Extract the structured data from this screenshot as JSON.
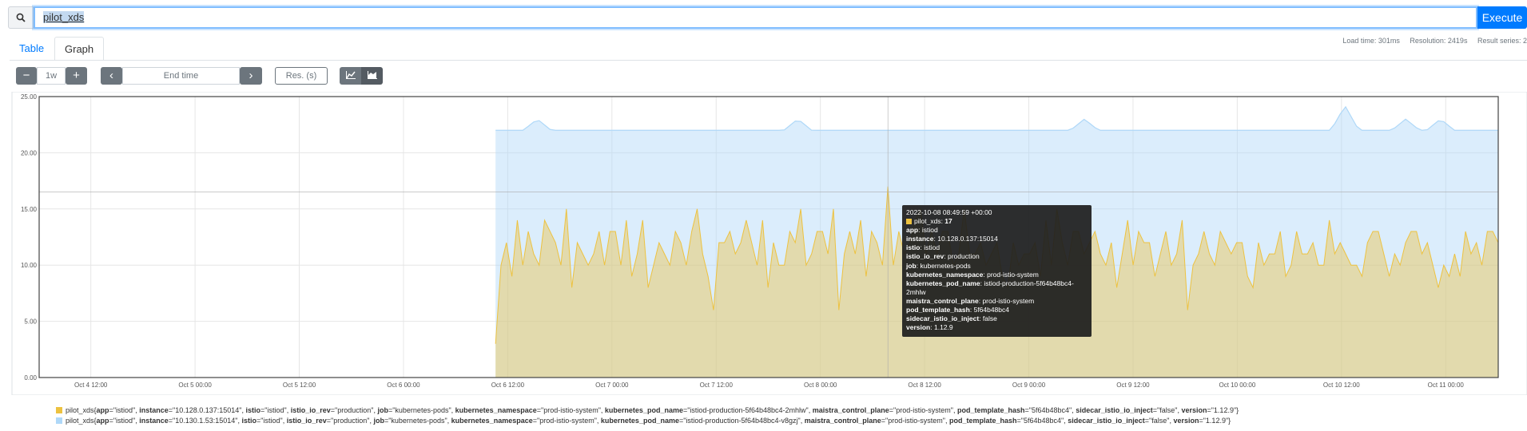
{
  "query": {
    "value": "pilot_xds"
  },
  "execute_label": "Execute",
  "tabs": [
    {
      "label": "Table"
    },
    {
      "label": "Graph"
    }
  ],
  "stats": {
    "load_time": "Load time: 301ms",
    "resolution": "Resolution: 2419s",
    "result_series": "Result series: 2"
  },
  "controls": {
    "minus": "−",
    "range": "1w",
    "plus": "+",
    "prev": "‹",
    "end_time_placeholder": "End time",
    "next": "›",
    "res_placeholder": "Res. (s)"
  },
  "colors": {
    "series1": "#edc240",
    "series2": "#afd8f8",
    "accent": "#007bff"
  },
  "icons": [
    "search-icon",
    "line-chart-icon",
    "stacked-chart-icon"
  ],
  "chart_data": {
    "type": "area",
    "stacked": true,
    "ylim": [
      0,
      25
    ],
    "y_ticks": [
      "0.00",
      "5.00",
      "10.00",
      "15.00",
      "20.00",
      "25.00"
    ],
    "x_ticks": [
      "Oct 4 12:00",
      "Oct 5 00:00",
      "Oct 5 12:00",
      "Oct 6 00:00",
      "Oct 6 12:00",
      "Oct 7 00:00",
      "Oct 7 12:00",
      "Oct 8 00:00",
      "Oct 8 12:00",
      "Oct 9 00:00",
      "Oct 9 12:00",
      "Oct 10 00:00",
      "Oct 10 12:00",
      "Oct 11 00:00"
    ],
    "x_ticks_hours": [
      12,
      24,
      36,
      48,
      60,
      72,
      84,
      96,
      108,
      120,
      132,
      144,
      156,
      168
    ],
    "x_range_hours": [
      6.05,
      174.05
    ],
    "series_start_hours": 58.6,
    "series": [
      {
        "name": "pilot_xds{app=\"istiod\", instance=\"10.128.0.137:15014\", istio=\"istiod\", istio_io_rev=\"production\", job=\"kubernetes-pods\", kubernetes_namespace=\"prod-istio-system\", kubernetes_pod_name=\"istiod-production-5f64b48bc4-2mhlw\", maistra_control_plane=\"prod-istio-system\", pod_template_hash=\"5f64b48bc4\", sidecar_istio_io_inject=\"false\", version=\"1.12.9\"}",
        "values": [
          3,
          10,
          12,
          9,
          14,
          10,
          13,
          11,
          10,
          14,
          13,
          12,
          10,
          15,
          8,
          12,
          11,
          10,
          11,
          13,
          10,
          13,
          13,
          10,
          14,
          9,
          11,
          14,
          8,
          10,
          12,
          11,
          10,
          13,
          12,
          10,
          13,
          15,
          11,
          9,
          6,
          12,
          12,
          13,
          11,
          12,
          14,
          12,
          10,
          14,
          8,
          12,
          10,
          10,
          13,
          12,
          15,
          10,
          11,
          13,
          13,
          11,
          15,
          6,
          11,
          13,
          11,
          14,
          9,
          13,
          12,
          10,
          17,
          10,
          13,
          11,
          12,
          14,
          15,
          11,
          13,
          11,
          13,
          13,
          10,
          11,
          15,
          11,
          11,
          12,
          10,
          11,
          12,
          9,
          8,
          12,
          10,
          11,
          11,
          12,
          9,
          14,
          10,
          15,
          12,
          10,
          13,
          13,
          11,
          12,
          13,
          11,
          10,
          12,
          8,
          11,
          14,
          10,
          13,
          12,
          12,
          9,
          11,
          13,
          10,
          11,
          14,
          6,
          10,
          11,
          13,
          11,
          10,
          13,
          12,
          11,
          12,
          12,
          9,
          8,
          12,
          10,
          11,
          11,
          13,
          9,
          10,
          13,
          11,
          11,
          12,
          10,
          10,
          14,
          11,
          12,
          11,
          10,
          10,
          9,
          12,
          13,
          13,
          11,
          9,
          11,
          10,
          12,
          13,
          13,
          11,
          12,
          10,
          8,
          10,
          9,
          11,
          9,
          13,
          11,
          12,
          10,
          13,
          13,
          12
        ]
      },
      {
        "name": "pilot_xds{app=\"istiod\", instance=\"10.130.1.53:15014\", istio=\"istiod\", istio_io_rev=\"production\", job=\"kubernetes-pods\", kubernetes_namespace=\"prod-istio-system\", kubernetes_pod_name=\"istiod-production-5f64b48bc4-v8gzj\", maistra_control_plane=\"prod-istio-system\", pod_template_hash=\"5f64b48bc4\", sidecar_istio_io_inject=\"false\", version=\"1.12.9\"}",
        "stacked_total": 22,
        "spikes_hours": [
          [
            63.4,
            23
          ],
          [
            64.4,
            21.2
          ],
          [
            93.4,
            23
          ],
          [
            126.4,
            23
          ],
          [
            156.4,
            24.2
          ],
          [
            163.4,
            23
          ],
          [
            167.4,
            23
          ]
        ]
      }
    ]
  },
  "tooltip": {
    "time": "2022-10-08 08:49:59 +00:00",
    "metric": "pilot_xds",
    "value": "17",
    "labels": [
      {
        "k": "app",
        "v": "istiod"
      },
      {
        "k": "instance",
        "v": "10.128.0.137:15014"
      },
      {
        "k": "istio",
        "v": "istiod"
      },
      {
        "k": "istio_io_rev",
        "v": "production"
      },
      {
        "k": "job",
        "v": "kubernetes-pods"
      },
      {
        "k": "kubernetes_namespace",
        "v": "prod-istio-system"
      },
      {
        "k": "kubernetes_pod_name",
        "v": "istiod-production-5f64b48bc4-2mhlw"
      },
      {
        "k": "maistra_control_plane",
        "v": "prod-istio-system"
      },
      {
        "k": "pod_template_hash",
        "v": "5f64b48bc4"
      },
      {
        "k": "sidecar_istio_io_inject",
        "v": "false"
      },
      {
        "k": "version",
        "v": "1.12.9"
      }
    ]
  },
  "legend": [
    {
      "metric": "pilot_xds",
      "labels": [
        {
          "k": "app",
          "v": "\"istiod\""
        },
        {
          "k": "instance",
          "v": "\"10.128.0.137:15014\""
        },
        {
          "k": "istio",
          "v": "\"istiod\""
        },
        {
          "k": "istio_io_rev",
          "v": "\"production\""
        },
        {
          "k": "job",
          "v": "\"kubernetes-pods\""
        },
        {
          "k": "kubernetes_namespace",
          "v": "\"prod-istio-system\""
        },
        {
          "k": "kubernetes_pod_name",
          "v": "\"istiod-production-5f64b48bc4-2mhlw\""
        },
        {
          "k": "maistra_control_plane",
          "v": "\"prod-istio-system\""
        },
        {
          "k": "pod_template_hash",
          "v": "\"5f64b48bc4\""
        },
        {
          "k": "sidecar_istio_io_inject",
          "v": "\"false\""
        },
        {
          "k": "version",
          "v": "\"1.12.9\""
        }
      ]
    },
    {
      "metric": "pilot_xds",
      "labels": [
        {
          "k": "app",
          "v": "\"istiod\""
        },
        {
          "k": "instance",
          "v": "\"10.130.1.53:15014\""
        },
        {
          "k": "istio",
          "v": "\"istiod\""
        },
        {
          "k": "istio_io_rev",
          "v": "\"production\""
        },
        {
          "k": "job",
          "v": "\"kubernetes-pods\""
        },
        {
          "k": "kubernetes_namespace",
          "v": "\"prod-istio-system\""
        },
        {
          "k": "kubernetes_pod_name",
          "v": "\"istiod-production-5f64b48bc4-v8gzj\""
        },
        {
          "k": "maistra_control_plane",
          "v": "\"prod-istio-system\""
        },
        {
          "k": "pod_template_hash",
          "v": "\"5f64b48bc4\""
        },
        {
          "k": "sidecar_istio_io_inject",
          "v": "\"false\""
        },
        {
          "k": "version",
          "v": "\"1.12.9\""
        }
      ]
    }
  ]
}
